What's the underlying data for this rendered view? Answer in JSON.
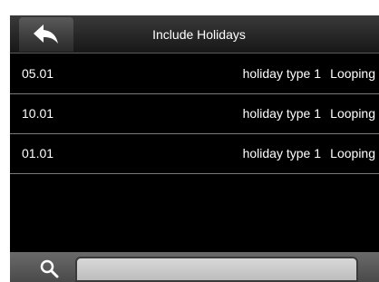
{
  "header": {
    "title": "Include Holidays",
    "back_icon": "back-arrow-icon"
  },
  "holidays": [
    {
      "date": "05.01",
      "type": "holiday type 1",
      "mode": "Looping"
    },
    {
      "date": "10.01",
      "type": "holiday type 1",
      "mode": "Looping"
    },
    {
      "date": "01.01",
      "type": "holiday type 1",
      "mode": "Looping"
    }
  ],
  "search": {
    "icon": "search-icon",
    "value": ""
  },
  "colors": {
    "background": "#000000",
    "text": "#ffffff",
    "divider": "#7a7a7a"
  }
}
